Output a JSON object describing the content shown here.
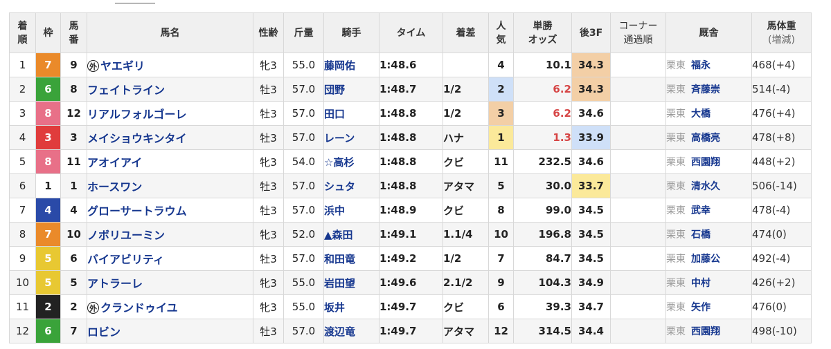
{
  "headers": {
    "rank": "着\n順",
    "frame": "枠",
    "number": "馬\n番",
    "horse": "馬名",
    "sex_age": "性齢",
    "weight_carried": "斤量",
    "jockey": "騎手",
    "time": "タイム",
    "margin": "着差",
    "popularity": "人\n気",
    "odds": "単勝\nオッズ",
    "last3f": "後3F",
    "corner": "コーナー\n通過順",
    "trainer": "厩舎",
    "body_weight": "馬体重",
    "body_weight_sub": "(増減)"
  },
  "foreign_mark": "外",
  "frame_colors": {
    "1": {
      "bg": "#ffffff",
      "fg": "#222222"
    },
    "2": {
      "bg": "#222222",
      "fg": "#ffffff"
    },
    "3": {
      "bg": "#e03c3c",
      "fg": "#ffffff"
    },
    "4": {
      "bg": "#2a4aa8",
      "fg": "#ffffff"
    },
    "5": {
      "bg": "#e8c832",
      "fg": "#ffffff"
    },
    "6": {
      "bg": "#3aa33a",
      "fg": "#ffffff"
    },
    "7": {
      "bg": "#ea8a2a",
      "fg": "#ffffff"
    },
    "8": {
      "bg": "#e87088",
      "fg": "#ffffff"
    }
  },
  "highlight_colors": {
    "first": "#fbe99a",
    "second": "#cfe0f8",
    "third": "#f3cfa6"
  },
  "rows": [
    {
      "rank": "1",
      "frame": "7",
      "number": "9",
      "foreign": true,
      "horse": "ヤエギリ",
      "sex_age": "牝3",
      "kinryo": "55.0",
      "jockey": "藤岡佑",
      "time": "1:48.6",
      "margin": "",
      "pop": "4",
      "odds": "10.1",
      "last3f": "34.3",
      "corner": "",
      "loc": "栗東",
      "trainer": "福永",
      "body": "468(+4)"
    },
    {
      "rank": "2",
      "frame": "6",
      "number": "8",
      "foreign": false,
      "horse": "フェイトライン",
      "sex_age": "牡3",
      "kinryo": "57.0",
      "jockey": "団野",
      "time": "1:48.7",
      "margin": "1/2",
      "pop": "2",
      "odds": "6.2",
      "last3f": "34.3",
      "corner": "",
      "loc": "栗東",
      "trainer": "斉藤崇",
      "body": "514(-4)"
    },
    {
      "rank": "3",
      "frame": "8",
      "number": "12",
      "foreign": false,
      "horse": "リアルフォルゴーレ",
      "sex_age": "牡3",
      "kinryo": "57.0",
      "jockey": "田口",
      "time": "1:48.8",
      "margin": "1/2",
      "pop": "3",
      "odds": "6.2",
      "last3f": "34.6",
      "corner": "",
      "loc": "栗東",
      "trainer": "大橋",
      "body": "476(+4)"
    },
    {
      "rank": "4",
      "frame": "3",
      "number": "3",
      "foreign": false,
      "horse": "メイショウキンタイ",
      "sex_age": "牡3",
      "kinryo": "57.0",
      "jockey": "レーン",
      "time": "1:48.8",
      "margin": "ハナ",
      "pop": "1",
      "odds": "1.3",
      "last3f": "33.9",
      "corner": "",
      "loc": "栗東",
      "trainer": "高橋亮",
      "body": "478(+8)"
    },
    {
      "rank": "5",
      "frame": "8",
      "number": "11",
      "foreign": false,
      "horse": "アオイアイ",
      "sex_age": "牝3",
      "kinryo": "54.0",
      "jockey": "☆高杉",
      "time": "1:48.8",
      "margin": "クビ",
      "pop": "11",
      "odds": "232.5",
      "last3f": "34.6",
      "corner": "",
      "loc": "栗東",
      "trainer": "西園翔",
      "body": "448(+2)"
    },
    {
      "rank": "6",
      "frame": "1",
      "number": "1",
      "foreign": false,
      "horse": "ホースワン",
      "sex_age": "牡3",
      "kinryo": "57.0",
      "jockey": "シュタ",
      "time": "1:48.8",
      "margin": "アタマ",
      "pop": "5",
      "odds": "30.0",
      "last3f": "33.7",
      "corner": "",
      "loc": "栗東",
      "trainer": "清水久",
      "body": "506(-14)"
    },
    {
      "rank": "7",
      "frame": "4",
      "number": "4",
      "foreign": false,
      "horse": "グローサートラウム",
      "sex_age": "牡3",
      "kinryo": "57.0",
      "jockey": "浜中",
      "time": "1:48.9",
      "margin": "クビ",
      "pop": "8",
      "odds": "99.0",
      "last3f": "34.5",
      "corner": "",
      "loc": "栗東",
      "trainer": "武幸",
      "body": "478(-4)"
    },
    {
      "rank": "8",
      "frame": "7",
      "number": "10",
      "foreign": false,
      "horse": "ノボリユーミン",
      "sex_age": "牝3",
      "kinryo": "52.0",
      "jockey": "▲森田",
      "time": "1:49.1",
      "margin": "1.1/4",
      "pop": "10",
      "odds": "196.8",
      "last3f": "34.5",
      "corner": "",
      "loc": "栗東",
      "trainer": "石橋",
      "body": "474(0)"
    },
    {
      "rank": "9",
      "frame": "5",
      "number": "6",
      "foreign": false,
      "horse": "バイアビリティ",
      "sex_age": "牡3",
      "kinryo": "57.0",
      "jockey": "和田竜",
      "time": "1:49.2",
      "margin": "1/2",
      "pop": "7",
      "odds": "84.7",
      "last3f": "34.5",
      "corner": "",
      "loc": "栗東",
      "trainer": "加藤公",
      "body": "492(-4)"
    },
    {
      "rank": "10",
      "frame": "5",
      "number": "5",
      "foreign": false,
      "horse": "アトラーレ",
      "sex_age": "牝3",
      "kinryo": "55.0",
      "jockey": "岩田望",
      "time": "1:49.6",
      "margin": "2.1/2",
      "pop": "9",
      "odds": "104.3",
      "last3f": "34.9",
      "corner": "",
      "loc": "栗東",
      "trainer": "中村",
      "body": "426(+2)"
    },
    {
      "rank": "11",
      "frame": "2",
      "number": "2",
      "foreign": true,
      "horse": "クランドゥイユ",
      "sex_age": "牝3",
      "kinryo": "55.0",
      "jockey": "坂井",
      "time": "1:49.7",
      "margin": "クビ",
      "pop": "6",
      "odds": "39.3",
      "last3f": "34.7",
      "corner": "",
      "loc": "栗東",
      "trainer": "矢作",
      "body": "476(0)"
    },
    {
      "rank": "12",
      "frame": "6",
      "number": "7",
      "foreign": false,
      "horse": "ロビン",
      "sex_age": "牡3",
      "kinryo": "57.0",
      "jockey": "渡辺竜",
      "time": "1:49.7",
      "margin": "アタマ",
      "pop": "12",
      "odds": "314.5",
      "last3f": "34.4",
      "corner": "",
      "loc": "栗東",
      "trainer": "西園翔",
      "body": "498(-10)"
    }
  ]
}
